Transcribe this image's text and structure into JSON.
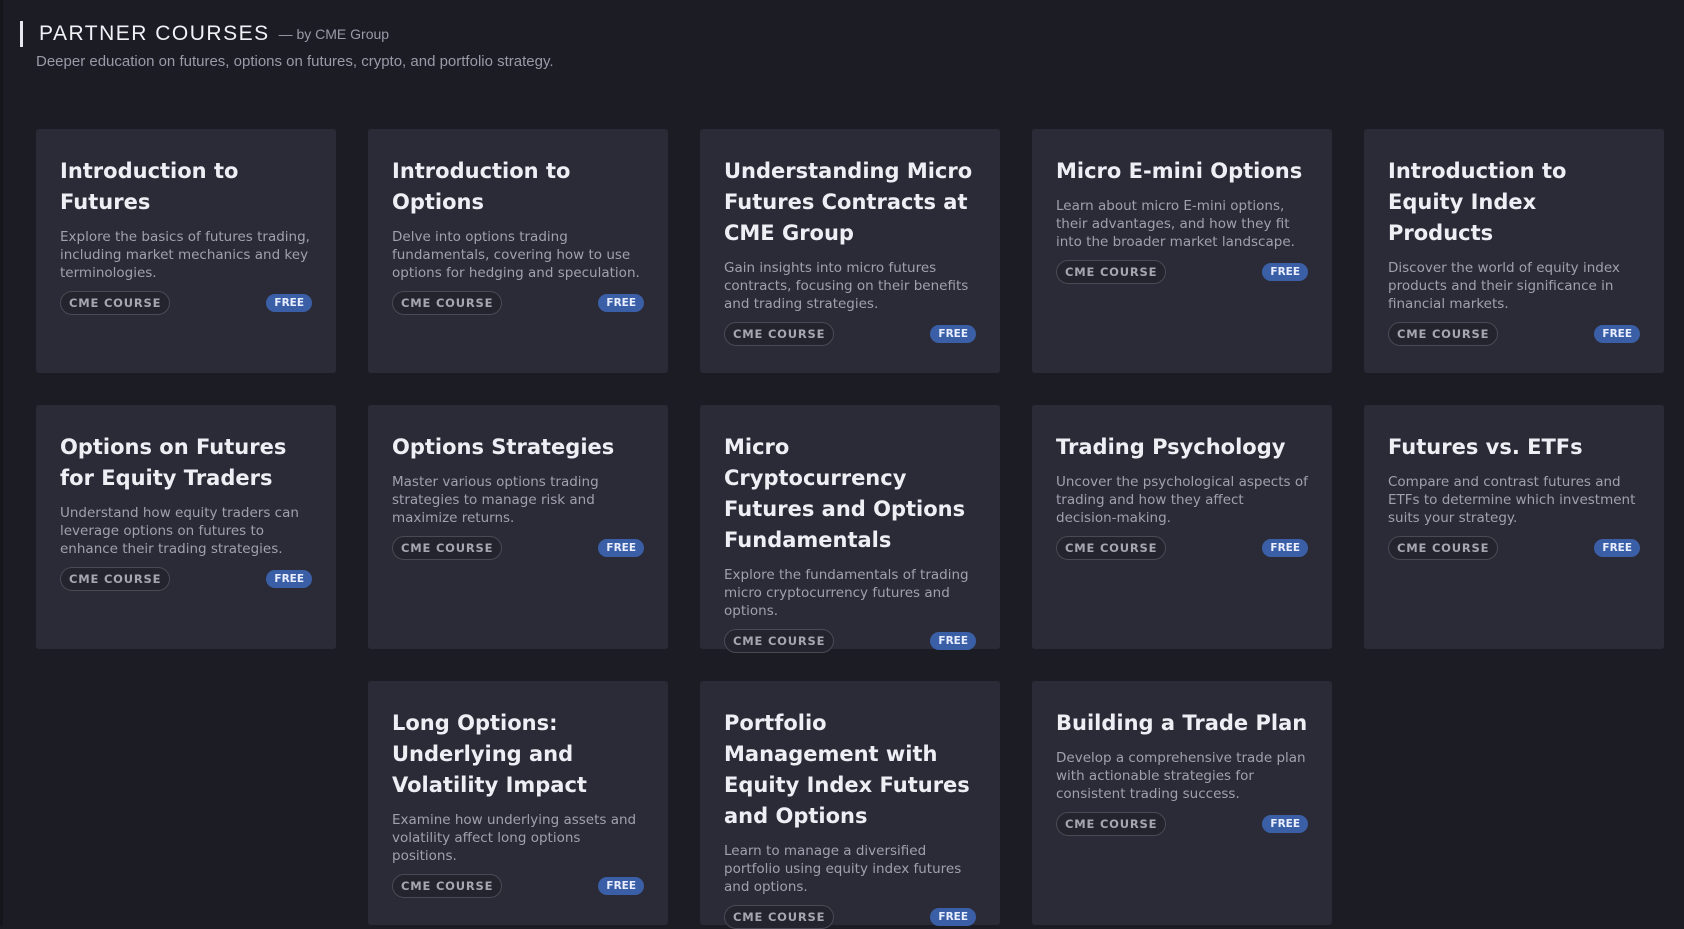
{
  "header": {
    "title": "PARTNER COURSES",
    "byline": "— by CME Group",
    "subtitle": "Deeper education on futures, options on futures, crypto, and portfolio strategy."
  },
  "colors": {
    "background": "#1c1c25",
    "card": "#2b2b37",
    "free_badge": "#3b5fa6"
  },
  "courses": [
    {
      "title": "Introduction to Futures",
      "desc": "Explore the basics of futures trading, including market mechanics and key terminologies.",
      "tag": "CME COURSE",
      "badge": "FREE"
    },
    {
      "title": "Introduction to Options",
      "desc": "Delve into options trading fundamentals, covering how to use options for hedging and speculation.",
      "tag": "CME COURSE",
      "badge": "FREE"
    },
    {
      "title": "Understanding Micro Futures Contracts at CME Group",
      "desc": "Gain insights into micro futures contracts, focusing on their benefits and trading strategies.",
      "tag": "CME COURSE",
      "badge": "FREE"
    },
    {
      "title": "Micro E-mini Options",
      "desc": "Learn about micro E-mini options, their advantages, and how they fit into the broader market landscape.",
      "tag": "CME COURSE",
      "badge": "FREE"
    },
    {
      "title": "Introduction to Equity Index Products",
      "desc": "Discover the world of equity index products and their significance in financial markets.",
      "tag": "CME COURSE",
      "badge": "FREE"
    },
    {
      "title": "Options on Futures for Equity Traders",
      "desc": "Understand how equity traders can leverage options on futures to enhance their trading strategies.",
      "tag": "CME COURSE",
      "badge": "FREE"
    },
    {
      "title": "Options Strategies",
      "desc": "Master various options trading strategies to manage risk and maximize returns.",
      "tag": "CME COURSE",
      "badge": "FREE"
    },
    {
      "title": "Micro Cryptocurrency Futures and Options Fundamentals",
      "desc": "Explore the fundamentals of trading micro cryptocurrency futures and options.",
      "tag": "CME COURSE",
      "badge": "FREE"
    },
    {
      "title": "Trading Psychology",
      "desc": "Uncover the psychological aspects of trading and how they affect decision-making.",
      "tag": "CME COURSE",
      "badge": "FREE"
    },
    {
      "title": "Futures vs. ETFs",
      "desc": "Compare and contrast futures and ETFs to determine which investment suits your strategy.",
      "tag": "CME COURSE",
      "badge": "FREE"
    },
    {
      "title": "Long Options: Underlying and Volatility Impact",
      "desc": "Examine how underlying assets and volatility affect long options positions.",
      "tag": "CME COURSE",
      "badge": "FREE"
    },
    {
      "title": "Portfolio Management with Equity Index Futures and Options",
      "desc": "Learn to manage a diversified portfolio using equity index futures and options.",
      "tag": "CME COURSE",
      "badge": "FREE"
    },
    {
      "title": "Building a Trade Plan",
      "desc": "Develop a comprehensive trade plan with actionable strategies for consistent trading success.",
      "tag": "CME COURSE",
      "badge": "FREE"
    }
  ]
}
